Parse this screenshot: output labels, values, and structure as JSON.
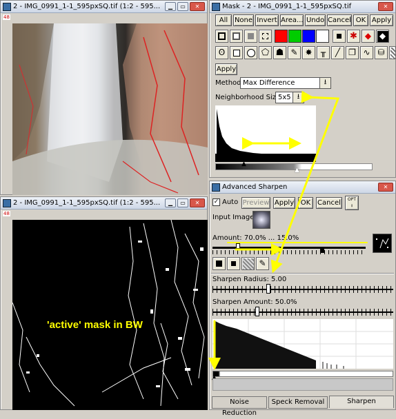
{
  "image_window_top": {
    "title": "2 - IMG_0991_1-1_595pxSQ.tif (1:2 - 595...",
    "corner_badge": "48"
  },
  "image_window_bottom": {
    "title": "2 - IMG_0991_1-1_595pxSQ.tif (1:2 - 595...",
    "corner_badge": "48",
    "annotation": "'active' mask in BW"
  },
  "mask_window": {
    "title": "Mask - 2 - IMG_0991_1-1_595pxSQ.tif",
    "buttons": [
      "All",
      "None",
      "Invert",
      "Area...",
      "Undo",
      "Cancel",
      "OK",
      "Apply"
    ],
    "apply_label": "Apply",
    "method_label": "Method:",
    "method_value": "Max Difference",
    "neighborhood_label": "Neighborhood Size:",
    "neighborhood_value": "5x5",
    "swatch_colors": [
      "#ff0000",
      "#00cc00",
      "#0000ff",
      "#ffffff"
    ]
  },
  "sharpen_window": {
    "title": "Advanced Sharpen",
    "auto_label": "Auto",
    "preview_label": "Preview",
    "apply_label": "Apply",
    "ok_label": "OK",
    "cancel_label": "Cancel",
    "opt_label": "OPT",
    "input_image_label": "Input Image:",
    "amount_label": "Amount: 70.0% ... 15.0%",
    "radius_label": "Sharpen Radius: 5.00",
    "sharpen_amount_label": "Sharpen Amount: 50.0%",
    "tabs": [
      "Noise Reduction",
      "Speck Removal",
      "Sharpen"
    ]
  },
  "colors": {
    "annotation_yellow": "#ffff00",
    "arrow_yellow": "#ffff00"
  }
}
